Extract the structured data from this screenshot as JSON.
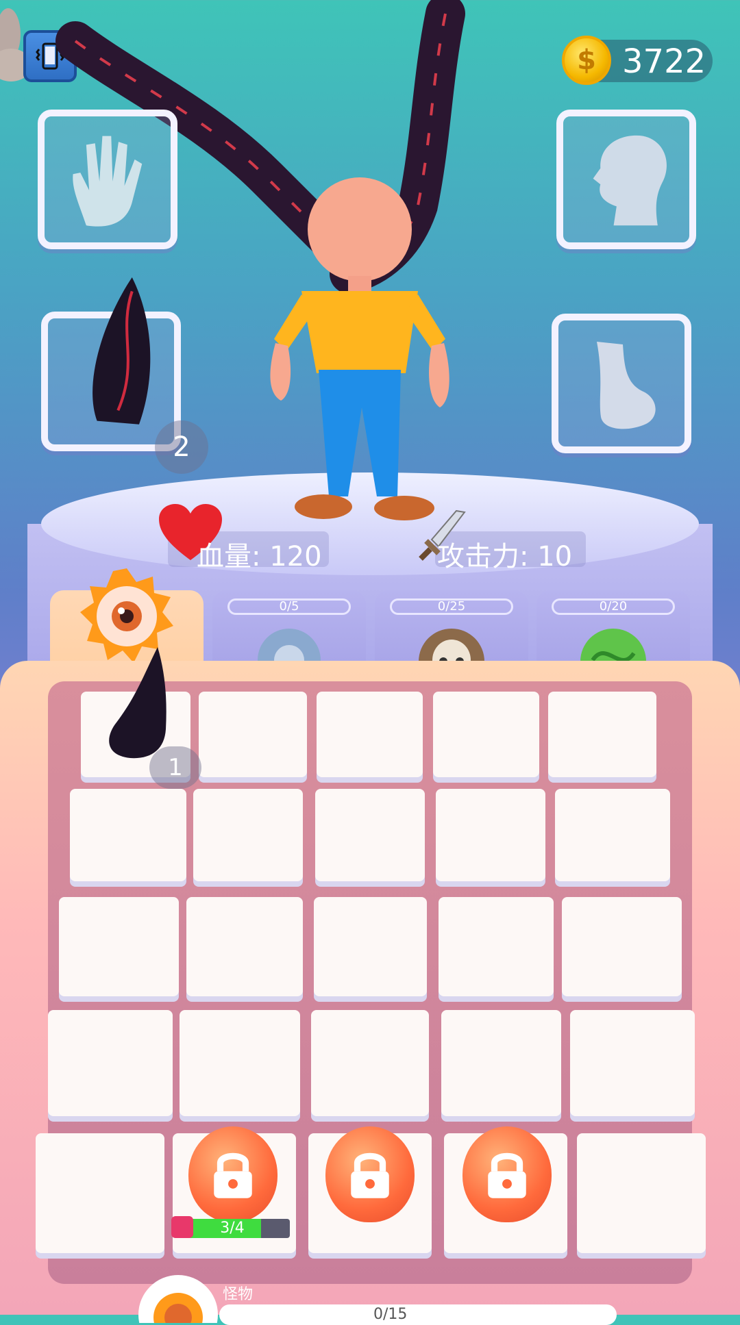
{
  "coins": "3722",
  "slots": {
    "hand": {
      "icon": "hand-icon"
    },
    "head": {
      "icon": "head-icon"
    },
    "horn": {
      "icon": "horn-icon",
      "count": "2"
    },
    "foot": {
      "icon": "foot-icon"
    }
  },
  "stats": {
    "hp_label": "血量: 120",
    "attack_label": "攻击力: 10"
  },
  "tabs": [
    {
      "icon": "eye-icon",
      "progress": "",
      "active": true
    },
    {
      "icon": "gear-icon",
      "progress": "0/5"
    },
    {
      "icon": "skull-icon",
      "progress": "0/25"
    },
    {
      "icon": "vine-icon",
      "progress": "0/20"
    }
  ],
  "board": {
    "horn_piece_count": "1",
    "locked_cell_progress": "3/4",
    "locked_cell_fraction": 0.75
  },
  "bottom": {
    "label": "怪物",
    "progress": "0/15"
  }
}
